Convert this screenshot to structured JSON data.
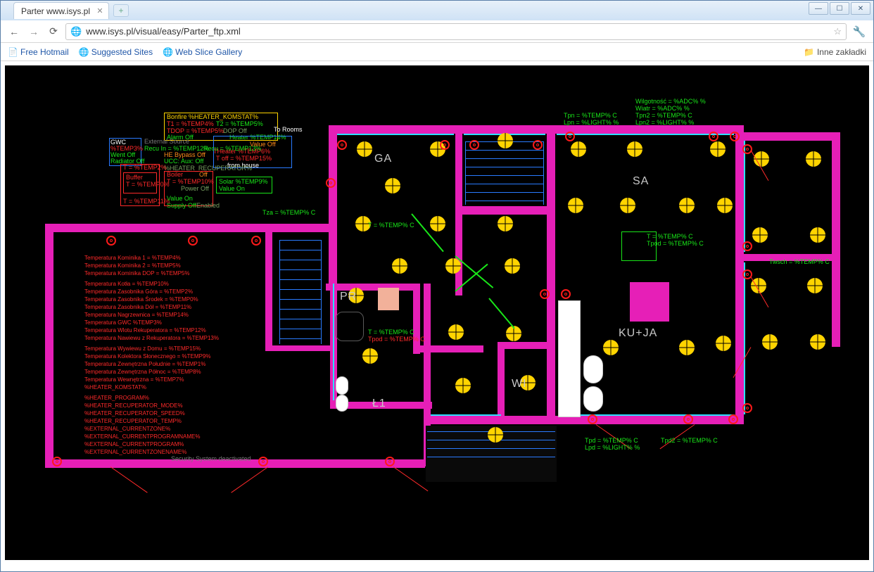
{
  "window": {
    "tab_title": "Parter www.isys.pl",
    "url": "www.isys.pl/visual/easy/Parter_ftp.xml"
  },
  "bookmarks": {
    "b1": "Free Hotmail",
    "b2": "Suggested Sites",
    "b3": "Web Slice Gallery",
    "other": "Inne zakładki"
  },
  "info_boxes": {
    "bonfire": {
      "title": "Bonfire %HEATER_KOMSTAT%",
      "l1a": "T1 = %TEMP4%",
      "l1b": "T2 = %TEMP5%",
      "l2a": "TDOP = %TEMP5%",
      "l2b": "DOP Off",
      "l3": "Alarm Off"
    },
    "gwc": {
      "title": "GWC",
      "l1": "%TEMP3%",
      "l2": "Went Off",
      "l3": "Radiator Off"
    },
    "ext_source": {
      "title": "External Source",
      "l1": "Recu In = %TEMP12%",
      "toff": "Recu = %TEMP13%"
    },
    "hebypass": "HE Bypass Off",
    "ucc": "UCC: Aux: Off",
    "heater_recup": "%HEATER_RECUPERATOR%",
    "boiler": {
      "title": "Boiler",
      "off": "Off",
      "t": "T = %TEMP10%",
      "power": "Power Off"
    },
    "buffer": {
      "title": "Buffer",
      "t": "T = %TEMP0%"
    },
    "t2": "T = %TEMP2%",
    "t11": "T = %TEMP11%",
    "solar": {
      "title": "Solar %TEMP9%",
      "value": "Value On"
    },
    "heater14": {
      "title": "Heater %TEMP14%",
      "value": "Value Off",
      "threshold": "THeater %TEMP6%",
      "toff": "T off = %TEMP15%",
      "from": "from house"
    },
    "torooms": "To Rooms",
    "valueon": "Value On",
    "supply": "Supply Off",
    "enabled": "Enabled"
  },
  "readings": {
    "tza": "Tza = %TEMP% C",
    "tga": "T = %TEMP% C",
    "tpr": "T = %TEMP% C",
    "tpodpr": "Tpod = %TEMP% C",
    "tpn": "Tpn = %TEMP% C",
    "lpn": "Lpn = %LIGHT% %",
    "wilg": "Wilgotność = %ADC% %",
    "wiatr": "Wiatr = %ADC% %",
    "tpn2": "Tpn2 = %TEMP% C",
    "lpn2": "Lpn2 = %LIGHT% %",
    "tsa": "T = %TEMP% C",
    "tpodsa": "Tpod = %TEMP% C",
    "twsch": "Twsch = %TEMP% C",
    "tpd": "Tpd = %TEMP% C",
    "lpd": "Lpd = %LIGHT% %",
    "tpd2": "Tpd2 = %TEMP% C"
  },
  "rooms": {
    "ga": "GA",
    "sa": "SA",
    "pr": "PR",
    "kuja": "KU+JA",
    "wi": "WI",
    "l1": "Ł1"
  },
  "leftlist": {
    "t1": "Temperatura Kominika 1 = %TEMP4%",
    "t2": "Temperatura Kominika 2 = %TEMP5%",
    "t3": "Temperatura Kominika DOP = %TEMP5%",
    "t4": "Temperatura Kotła = %TEMP10%",
    "t5": "Temperatura Zasobnika Góra = %TEMP2%",
    "t6": "Temperatura Zasobnika Środek = %TEMP0%",
    "t7": "Temperatura Zasobnika Dół = %TEMP11%",
    "t8": "Temperatura Nagrzewnica = %TEMP14%",
    "t9": "Temperatura GWC %TEMP3%",
    "t10": "Temperatura Wlotu Rekuperatora = %TEMP12%",
    "t11": "Temperatura Nawiewu z Rekuperatora = %TEMP13%",
    "t12": "Temperatura Wywiewu z Domu = %TEMP15%",
    "t13": "Temperatura Kolektora Słonecznego = %TEMP9%",
    "t14": "Temperatura Zewnętrzna Południe = %TEMP1%",
    "t15": "Temperatura Zewnętrzna Północ = %TEMP8%",
    "t16": "Temperatura Wewnętrzna = %TEMP7%",
    "t17": "%HEATER_KOMSTAT%",
    "t18": "%HEATER_PROGRAM%",
    "t19": "%HEATER_RECUPERATOR_MODE%",
    "t20": "%HEATER_RECUPERATOR_SPEED%",
    "t21": "%HEATER_RECUPERATOR_TEMP%",
    "t22": "%EXTERNAL_CURRENTZONE%",
    "t23": "%EXTERNAL_CURRENTPROGRAMNAME%",
    "t24": "%EXTERNAL_CURRENTPROGRAM%",
    "t25": "%EXTERNAL_CURRENTZONENAME%"
  },
  "security": "Security System deactivated"
}
